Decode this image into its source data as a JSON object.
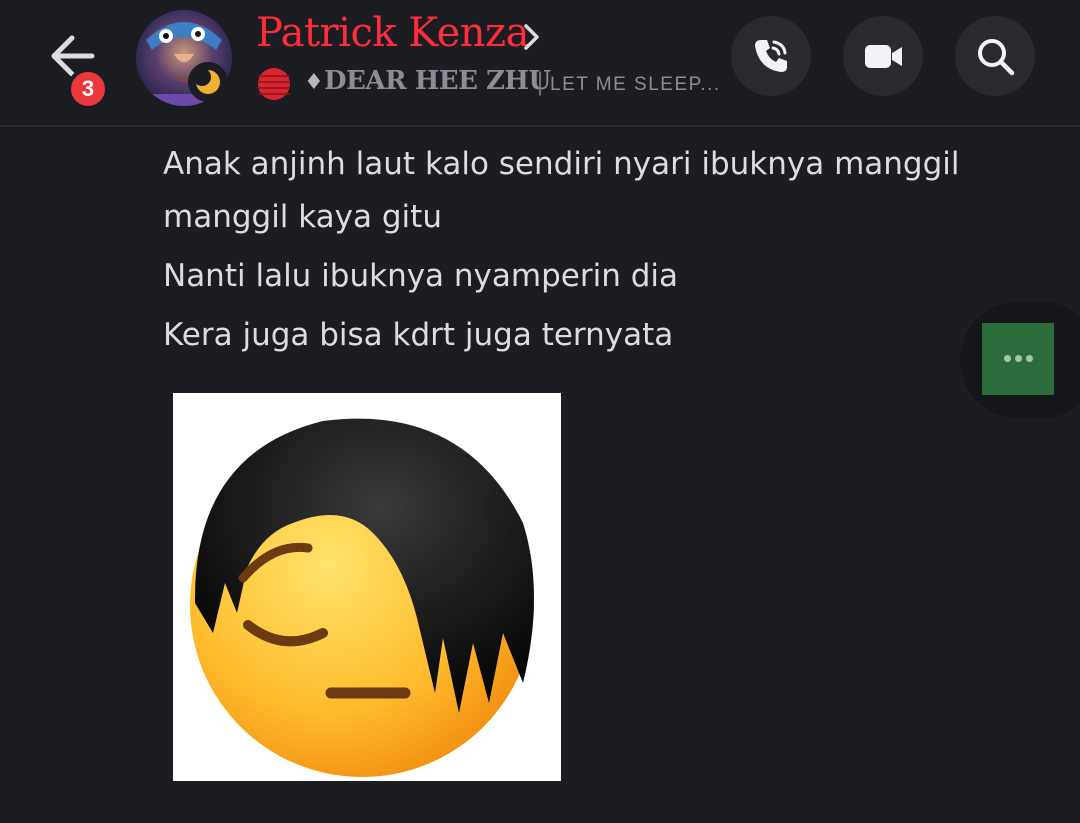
{
  "header": {
    "unread_count": "3",
    "user_name": "Patrick Kenza",
    "sub_diamond": "♦",
    "sub_title": "DEAR HEE ZHU",
    "sub_separator": "|",
    "custom_status": "LET ME SLEEP...",
    "icons": {
      "back": "arrow-left-icon",
      "profile": "chevron-right-icon",
      "call": "phone-icon",
      "video": "video-camera-icon",
      "search": "search-icon",
      "status": "moon-icon"
    }
  },
  "messages": [
    {
      "text": "Anak anjinh laut kalo sendiri nyari ibuknya manggil manggil kaya gitu"
    },
    {
      "text": "Nanti lalu ibuknya nyamperin dia"
    },
    {
      "text": "Kera juga bisa kdrt juga ternyata"
    }
  ],
  "attachment": {
    "type": "image",
    "depicts": "pensive emoji with black hair"
  },
  "side_menu": {
    "icon": "more-dots-icon"
  },
  "colors": {
    "background": "#1c1d22",
    "username": "#ff2d3a",
    "badge": "#e8383d",
    "icon_button": "#2a2b31",
    "more_button": "#2a6d3b"
  }
}
